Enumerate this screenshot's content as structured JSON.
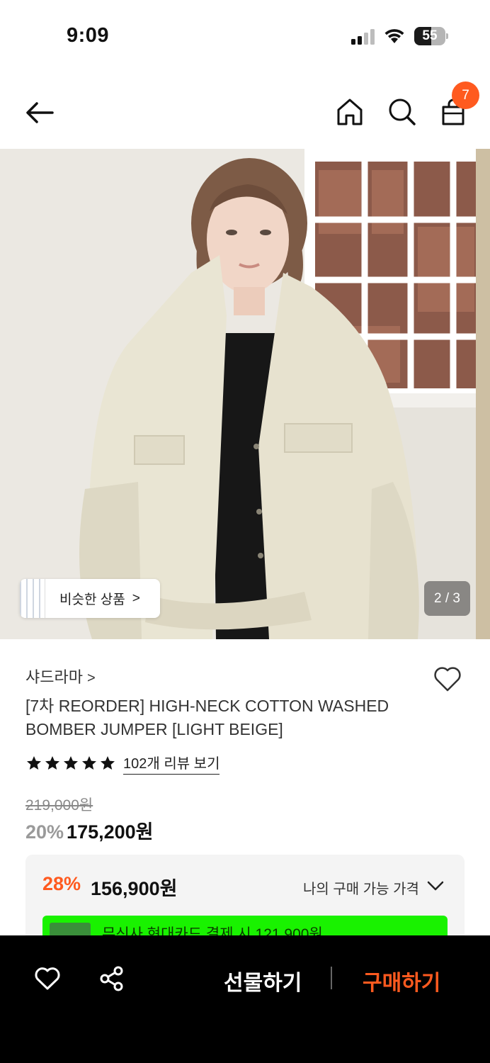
{
  "status_bar": {
    "time": "9:09",
    "battery": "55",
    "battery_level_percent": 55
  },
  "nav": {
    "cart_count": "7",
    "accent_color": "#ff5a1f"
  },
  "gallery": {
    "similar_label": "비슷한 상품",
    "similar_chevron": ">",
    "pager": "2 / 3"
  },
  "product": {
    "brand": "샤드라마",
    "brand_chevron": ">",
    "title": "[7차 REORDER] HIGH-NECK COTTON WASHED BOMBER JUMPER [LIGHT BEIGE]",
    "rating_stars": 5,
    "review_link": "102개 리뷰 보기",
    "original_price": "219,000원",
    "discount": "20%",
    "sale_price": "175,200원"
  },
  "offer": {
    "discount": "28%",
    "price": "156,900원",
    "my_price_label": "나의 구매 가능 가격",
    "promo_text": "무신사 현대카드 결제 시 121,900원",
    "promo_color": "#19f200"
  },
  "bottom_bar": {
    "gift_label": "선물하기",
    "buy_label": "구매하기"
  }
}
